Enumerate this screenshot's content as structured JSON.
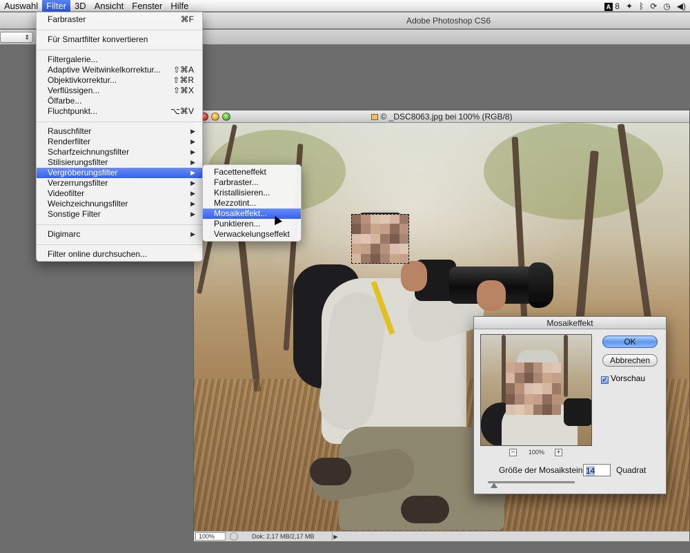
{
  "menubar": {
    "items": [
      "Auswahl",
      "Filter",
      "3D",
      "Ansicht",
      "Fenster",
      "Hilfe"
    ],
    "active": "Filter",
    "tray": {
      "adobe_badge": "8"
    }
  },
  "app": {
    "title": "Adobe Photoshop CS6"
  },
  "document": {
    "title": "_DSC8063.jpg bei 100% (RGB/8)",
    "copyright_symbol": "©",
    "status_zoom": "100%",
    "status_doc": "Dok: 2,17 MB/2,17 MB"
  },
  "filter_menu": {
    "groups": [
      [
        {
          "label": "Farbraster",
          "shortcut": "⌘F"
        }
      ],
      [
        {
          "label": "Für Smartfilter konvertieren",
          "shortcut": ""
        }
      ],
      [
        {
          "label": "Filtergalerie...",
          "shortcut": ""
        },
        {
          "label": "Adaptive Weitwinkelkorrektur...",
          "shortcut": "⇧⌘A"
        },
        {
          "label": "Objektivkorrektur...",
          "shortcut": "⇧⌘R"
        },
        {
          "label": "Verflüssigen...",
          "shortcut": "⇧⌘X"
        },
        {
          "label": "Ölfarbe...",
          "shortcut": ""
        },
        {
          "label": "Fluchtpunkt...",
          "shortcut": "⌥⌘V"
        }
      ],
      [
        {
          "label": "Rauschfilter",
          "submenu": true
        },
        {
          "label": "Renderfilter",
          "submenu": true
        },
        {
          "label": "Scharfzeichnungsfilter",
          "submenu": true
        },
        {
          "label": "Stilisierungsfilter",
          "submenu": true
        },
        {
          "label": "Vergröberungsfilter",
          "submenu": true,
          "highlight": true
        },
        {
          "label": "Verzerrungsfilter",
          "submenu": true
        },
        {
          "label": "Videofilter",
          "submenu": true
        },
        {
          "label": "Weichzeichnungsfilter",
          "submenu": true
        },
        {
          "label": "Sonstige Filter",
          "submenu": true
        }
      ],
      [
        {
          "label": "Digimarc",
          "submenu": true
        }
      ],
      [
        {
          "label": "Filter online durchsuchen...",
          "shortcut": ""
        }
      ]
    ]
  },
  "submenu": {
    "items": [
      {
        "label": "Facetteneffekt"
      },
      {
        "label": "Farbraster..."
      },
      {
        "label": "Kristallisieren..."
      },
      {
        "label": "Mezzotint..."
      },
      {
        "label": "Mosaikeffekt...",
        "highlight": true
      },
      {
        "label": "Punktieren..."
      },
      {
        "label": "Verwackelungseffekt"
      }
    ]
  },
  "dialog": {
    "title": "Mosaikeffekt",
    "ok_label": "OK",
    "cancel_label": "Abbrechen",
    "preview_checkbox_label": "Vorschau",
    "preview_checked": true,
    "zoom_minus": "−",
    "zoom_level": "100%",
    "zoom_plus": "+",
    "size_label": "Größe der Mosaiksteine:",
    "size_value": "14",
    "size_unit": "Quadrat",
    "slider_value": 0.06
  },
  "icons": {
    "submenu_arrow": "▶",
    "checkmark": "✓"
  },
  "colors": {
    "menu_highlight": "#3461ef",
    "app_background": "#6d6d6d"
  }
}
